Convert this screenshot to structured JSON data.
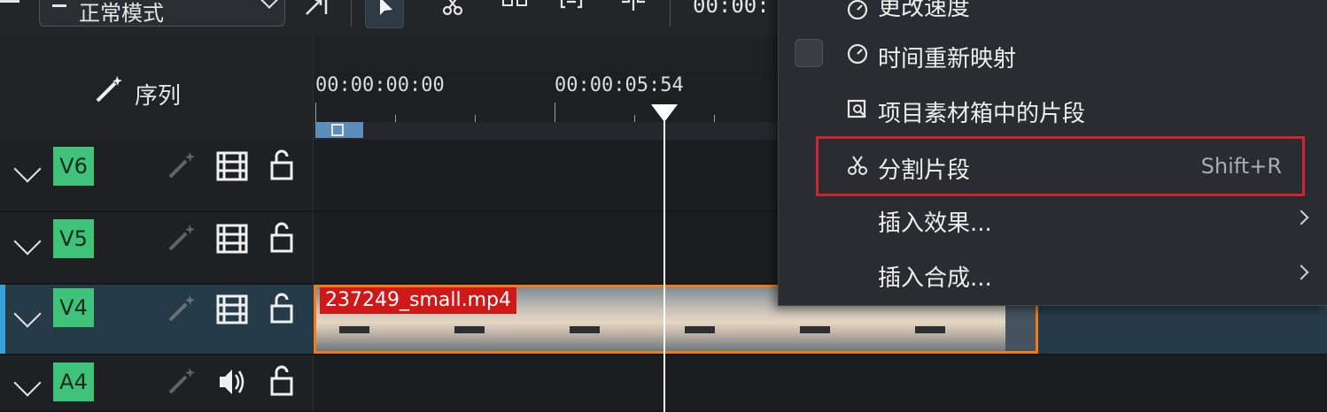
{
  "toolbar": {
    "mode_label": "正常模式",
    "timecode": "00:00:"
  },
  "sequence": {
    "label": "序列"
  },
  "ruler": {
    "tc_start": "00:00:00:00",
    "tc_mark": "00:00:05:54"
  },
  "tracks": [
    {
      "name": "V6",
      "kind": "video"
    },
    {
      "name": "V5",
      "kind": "video"
    },
    {
      "name": "V4",
      "kind": "video",
      "selected": true
    },
    {
      "name": "A4",
      "kind": "audio"
    }
  ],
  "clip": {
    "label": "237249_small.mp4"
  },
  "context_menu": {
    "items": [
      {
        "label": "更改速度"
      },
      {
        "label": "时间重新映射",
        "checkable": true,
        "checked": false
      },
      {
        "label": "项目素材箱中的片段"
      },
      {
        "label": "分割片段",
        "shortcut": "Shift+R",
        "highlighted": true
      },
      {
        "label": "插入效果...",
        "submenu": true
      },
      {
        "label": "插入合成...",
        "submenu": true
      }
    ]
  },
  "colors": {
    "track_tag": "#3fc27a",
    "clip_border": "#f07b1a",
    "clip_label_bg": "#d01818",
    "highlight_outline": "#d3232f",
    "selection_accent": "#3daee9"
  }
}
